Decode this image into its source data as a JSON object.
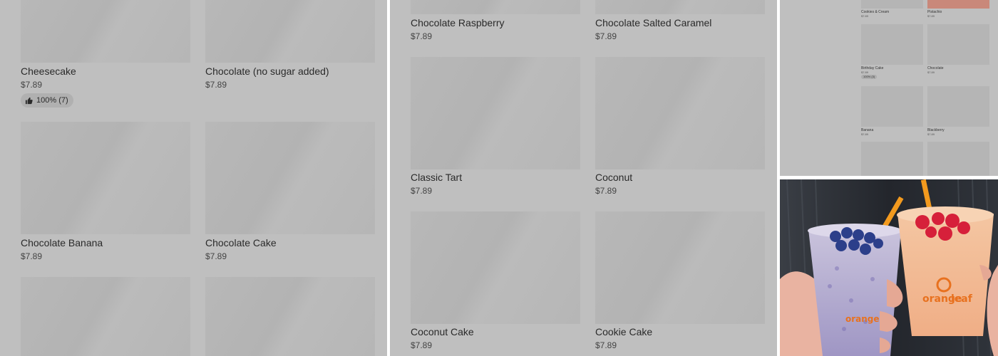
{
  "left_panel": {
    "items": [
      {
        "name": "Cheesecake",
        "price": "$7.89",
        "badge": "100% (7)"
      },
      {
        "name": "Chocolate (no sugar added)",
        "price": "$7.89"
      },
      {
        "name": "Chocolate Banana",
        "price": "$7.89"
      },
      {
        "name": "Chocolate Cake",
        "price": "$7.89"
      }
    ]
  },
  "middle_panel": {
    "items": [
      {
        "name": "Chocolate Raspberry",
        "price": "$7.89"
      },
      {
        "name": "Chocolate Salted Caramel",
        "price": "$7.89"
      },
      {
        "name": "Classic Tart",
        "price": "$7.89"
      },
      {
        "name": "Coconut",
        "price": "$7.89"
      },
      {
        "name": "Coconut Cake",
        "price": "$7.89"
      },
      {
        "name": "Cookie Cake",
        "price": "$7.89"
      }
    ]
  },
  "small_panel": {
    "items": [
      {
        "name": "Cookies & Cream",
        "price": "$7.89"
      },
      {
        "name": "Pistachio",
        "price": "$7.89"
      },
      {
        "name": "Birthday Cake",
        "price": "$7.89",
        "badge": "100% (3)"
      },
      {
        "name": "Chocolate",
        "price": "$7.89"
      },
      {
        "name": "Banana",
        "price": "$7.89"
      },
      {
        "name": "Blackberry",
        "price": "$7.89"
      }
    ]
  },
  "photo": {
    "brand_line1": "orange",
    "brand_line2": "leaf",
    "colors": {
      "straw": "#f39a1e",
      "brand": "#e8711f",
      "blueberry": "#2c3f8a",
      "raspberry": "#d6203a"
    }
  }
}
